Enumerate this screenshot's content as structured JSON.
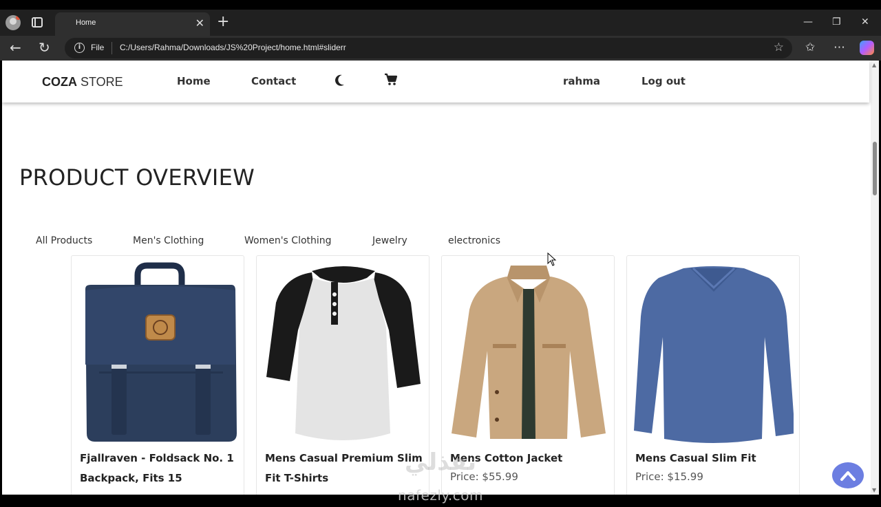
{
  "browser": {
    "tab_title": "Home",
    "tab_close": "✕",
    "new_tab": "+",
    "url_scheme": "File",
    "url": "C:/Users/Rahma/Downloads/JS%20Project/home.html#sliderr",
    "icons": [
      "profile-icon",
      "tab-actions-icon",
      "back-icon",
      "refresh-icon",
      "info-icon",
      "favorite-star-icon",
      "favorites-icon",
      "more-icon",
      "copilot-icon",
      "minimize-icon",
      "restore-icon",
      "close-icon"
    ]
  },
  "header": {
    "logo_bold": "COZA",
    "logo_rest": " STORE",
    "nav": {
      "home": "Home",
      "contact": "Contact"
    },
    "user": "rahma",
    "logout": "Log out",
    "icons": [
      "moon-icon",
      "cart-icon"
    ]
  },
  "main": {
    "title": "PRODUCT OVERVIEW",
    "filters": [
      "All Products",
      "Men's Clothing",
      "Women's Clothing",
      "Jewelry",
      "electronics"
    ],
    "products": [
      {
        "title": "Fjallraven - Foldsack No. 1 Backpack, Fits 15",
        "price": ""
      },
      {
        "title": "Mens Casual Premium Slim Fit T-Shirts",
        "price": ""
      },
      {
        "title": "Mens Cotton Jacket",
        "price": "Price: $55.99"
      },
      {
        "title": "Mens Casual Slim Fit",
        "price": "Price: $15.99"
      }
    ]
  },
  "watermark": {
    "arabic": "نفذلي",
    "latin": "nafezly.com"
  },
  "colors": {
    "scroll_top_button": "#6c7ee1",
    "backpack": "#2c3e5c",
    "jacket": "#c9a77f",
    "tshirt_blue": "#4d6aa3"
  }
}
